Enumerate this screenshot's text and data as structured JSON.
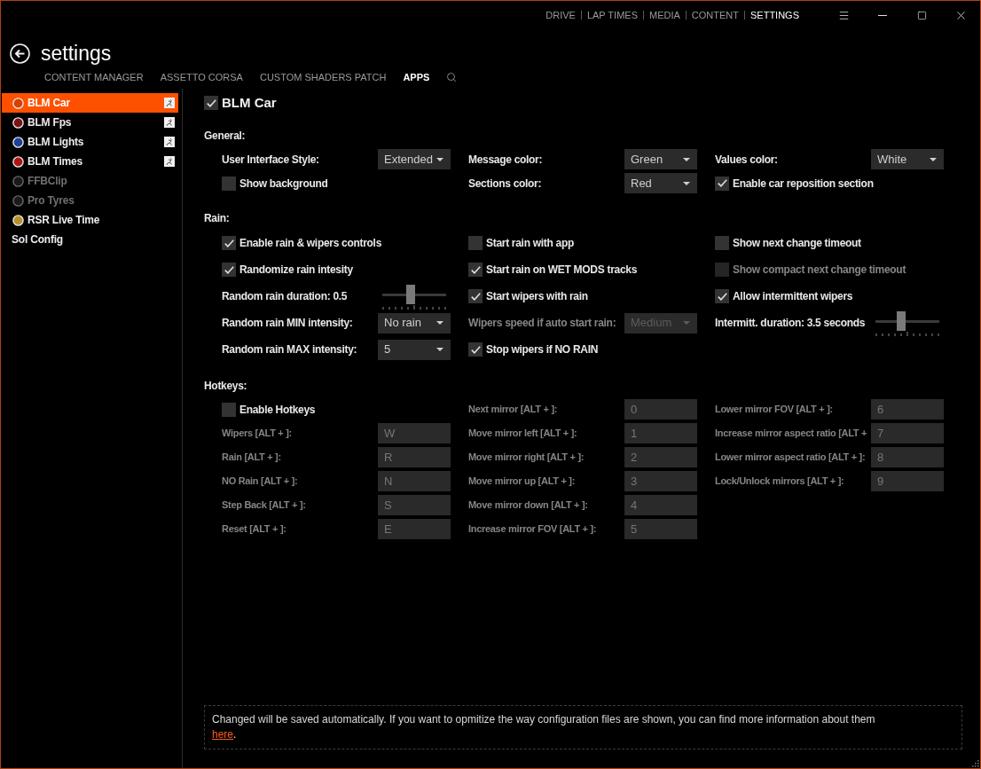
{
  "top_nav": [
    {
      "label": "DRIVE",
      "selected": false
    },
    {
      "label": "LAP TIMES",
      "selected": false
    },
    {
      "label": "MEDIA",
      "selected": false
    },
    {
      "label": "CONTENT",
      "selected": false
    },
    {
      "label": "SETTINGS",
      "selected": true
    }
  ],
  "page_title": "settings",
  "sub_tabs": [
    {
      "label": "CONTENT MANAGER",
      "selected": false
    },
    {
      "label": "ASSETTO CORSA",
      "selected": false
    },
    {
      "label": "CUSTOM SHADERS PATCH",
      "selected": false
    },
    {
      "label": "APPS",
      "selected": true
    }
  ],
  "sidebar": {
    "items": [
      {
        "label": "BLM Car",
        "selected": true,
        "disabled": false,
        "color": "#d84000",
        "badge": true
      },
      {
        "label": "BLM Fps",
        "selected": false,
        "disabled": false,
        "color": "#7a1414",
        "badge": true
      },
      {
        "label": "BLM Lights",
        "selected": false,
        "disabled": false,
        "color": "#1f3f9a",
        "badge": true
      },
      {
        "label": "BLM Times",
        "selected": false,
        "disabled": false,
        "color": "#b01515",
        "badge": true
      },
      {
        "label": "FFBClip",
        "selected": false,
        "disabled": true,
        "color": "#1a1a1a",
        "badge": false
      },
      {
        "label": "Pro Tyres",
        "selected": false,
        "disabled": true,
        "color": "#1a1a1a",
        "badge": false
      },
      {
        "label": "RSR Live Time",
        "selected": false,
        "disabled": false,
        "color": "#b8902c",
        "badge": false
      },
      {
        "label": "Sol Config",
        "selected": false,
        "disabled": false,
        "badge": false
      }
    ]
  },
  "app": {
    "label": "BLM Car",
    "checked": true
  },
  "sections": [
    {
      "title": "General:",
      "rows": [
        [
          {
            "kind": "dropdown",
            "label": "User Interface Style:",
            "value": "Extended",
            "disabled": false
          },
          {
            "kind": "dropdown",
            "label": "Message color:",
            "value": "Green",
            "disabled": false
          },
          {
            "kind": "dropdown",
            "label": "Values color:",
            "value": "White",
            "disabled": false
          }
        ],
        [
          {
            "kind": "checkbox",
            "label": "Show background",
            "checked": false,
            "disabled": false
          },
          {
            "kind": "dropdown",
            "label": "Sections color:",
            "value": "Red",
            "disabled": false
          },
          {
            "kind": "checkbox",
            "label": "Enable car reposition section",
            "checked": true,
            "disabled": false
          }
        ]
      ]
    },
    {
      "title": "Rain:",
      "rows": [
        [
          {
            "kind": "checkbox",
            "label": "Enable rain & wipers controls",
            "checked": true,
            "disabled": false
          },
          {
            "kind": "checkbox",
            "label": "Start rain with app",
            "checked": false,
            "disabled": false
          },
          {
            "kind": "checkbox",
            "label": "Show next change timeout",
            "checked": false,
            "disabled": false
          }
        ],
        [
          {
            "kind": "checkbox",
            "label": "Randomize rain intesity",
            "checked": true,
            "disabled": false
          },
          {
            "kind": "checkbox",
            "label": "Start rain on WET MODS tracks",
            "checked": true,
            "disabled": false
          },
          {
            "kind": "checkbox",
            "label": "Show compact next change timeout",
            "checked": false,
            "disabled": true
          }
        ],
        [
          {
            "kind": "slider",
            "label": "Random rain duration: 0.5",
            "level": 0.44,
            "disabled": false
          },
          {
            "kind": "checkbox",
            "label": "Start wipers with rain",
            "checked": true,
            "disabled": false
          },
          {
            "kind": "checkbox",
            "label": "Allow intermittent wipers",
            "checked": true,
            "disabled": false
          }
        ],
        [
          {
            "kind": "dropdown",
            "label": "Random rain MIN intensity:",
            "value": "No rain",
            "disabled": false
          },
          {
            "kind": "dropdown",
            "label": "Wipers speed if auto start rain:",
            "value": "Medium",
            "disabled": true
          },
          {
            "kind": "slider",
            "label": "Intermitt. duration: 3.5 seconds",
            "level": 0.38,
            "disabled": false
          }
        ],
        [
          {
            "kind": "dropdown",
            "label": "Random rain MAX intensity:",
            "value": "5",
            "disabled": false
          },
          {
            "kind": "checkbox",
            "label": "Stop wipers if NO RAIN",
            "checked": true,
            "disabled": false
          }
        ]
      ]
    },
    {
      "title": "Hotkeys:",
      "rows": [
        [
          {
            "kind": "checkbox",
            "label": "Enable Hotkeys",
            "checked": false,
            "disabled": false
          },
          {
            "kind": "field",
            "label": "Next mirror [ALT + ]:",
            "value": "0",
            "disabled": true
          },
          {
            "kind": "field",
            "label": "Lower mirror FOV [ALT + ]:",
            "value": "6",
            "disabled": true
          }
        ],
        [
          {
            "kind": "field",
            "label": "Wipers [ALT + ]:",
            "value": "W",
            "disabled": true
          },
          {
            "kind": "field",
            "label": "Move mirror left [ALT + ]:",
            "value": "1",
            "disabled": true
          },
          {
            "kind": "field",
            "label": "Increase mirror aspect ratio [ALT +",
            "value": "7",
            "disabled": true
          }
        ],
        [
          {
            "kind": "field",
            "label": "Rain [ALT + ]:",
            "value": "R",
            "disabled": true
          },
          {
            "kind": "field",
            "label": "Move mirror right [ALT + ]:",
            "value": "2",
            "disabled": true
          },
          {
            "kind": "field",
            "label": "Lower mirror aspect ratio [ALT + ]:",
            "value": "8",
            "disabled": true
          }
        ],
        [
          {
            "kind": "field",
            "label": "NO Rain [ALT + ]:",
            "value": "N",
            "disabled": true
          },
          {
            "kind": "field",
            "label": "Move mirror up [ALT + ]:",
            "value": "3",
            "disabled": true
          },
          {
            "kind": "field",
            "label": "Lock/Unlock mirrors [ALT + ]:",
            "value": "9",
            "disabled": true
          }
        ],
        [
          {
            "kind": "field",
            "label": "Step Back [ALT + ]:",
            "value": "S",
            "disabled": true
          },
          {
            "kind": "field",
            "label": "Move mirror down [ALT + ]:",
            "value": "4",
            "disabled": true
          }
        ],
        [
          {
            "kind": "field",
            "label": "Reset [ALT + ]:",
            "value": "E",
            "disabled": true
          },
          {
            "kind": "field",
            "label": "Increase mirror FOV [ALT + ]:",
            "value": "5",
            "disabled": true
          }
        ]
      ]
    }
  ],
  "notice": {
    "text": "Changed will be saved automatically. If you want to opmitize the way configuration files are shown, you can find more information about them",
    "link": "here",
    "end": "."
  }
}
